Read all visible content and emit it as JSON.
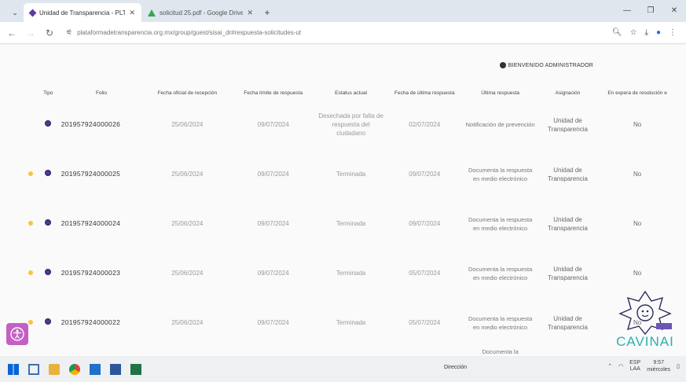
{
  "browser": {
    "tabs": [
      {
        "title": "Unidad de Transparencia - PLT",
        "active": true,
        "icon": "unidad-icon"
      },
      {
        "title": "solicitud 25.pdf - Google Drive",
        "active": false,
        "icon": "google-drive-icon"
      }
    ],
    "url": "plataformadetransparencia.org.mx/group/guest/sisai_dr#respuesta-solicitudes-ut",
    "new_tab": "+",
    "window_controls": [
      "—",
      "❐",
      "✕"
    ]
  },
  "header": {
    "welcome": "BIENVENIDO ADMINISTRADOR"
  },
  "table": {
    "columns": [
      "",
      "Tipo",
      "Folio",
      "Fecha oficial de recepción",
      "Fecha límite de respuesta",
      "Estatus actual",
      "Fecha de última respuesta",
      "Última respuesta",
      "Asignación",
      "En espera de resolución e"
    ],
    "rows": [
      {
        "marker": false,
        "folio": "201957924000026",
        "fecha_oficial": "25/06/2024",
        "fecha_limite": "09/07/2024",
        "estatus": "Desechada por falta de respuesta del ciudadano",
        "fecha_ultima": "02/07/2024",
        "ultima_respuesta": "Notificación de prevención",
        "asignacion": "Unidad de Transparencia",
        "espera": "No"
      },
      {
        "marker": true,
        "folio": "201957924000025",
        "fecha_oficial": "25/06/2024",
        "fecha_limite": "09/07/2024",
        "estatus": "Terminada",
        "fecha_ultima": "09/07/2024",
        "ultima_respuesta": "Documenta la respuesta en medio electrónico",
        "asignacion": "Unidad de Transparencia",
        "espera": "No"
      },
      {
        "marker": true,
        "folio": "201957924000024",
        "fecha_oficial": "25/06/2024",
        "fecha_limite": "09/07/2024",
        "estatus": "Terminada",
        "fecha_ultima": "09/07/2024",
        "ultima_respuesta": "Documenta la respuesta en medio electrónico",
        "asignacion": "Unidad de Transparencia",
        "espera": "No"
      },
      {
        "marker": true,
        "folio": "201957924000023",
        "fecha_oficial": "25/06/2024",
        "fecha_limite": "09/07/2024",
        "estatus": "Terminada",
        "fecha_ultima": "05/07/2024",
        "ultima_respuesta": "Documenta la respuesta en medio electrónico",
        "asignacion": "Unidad de Transparencia",
        "espera": "No"
      },
      {
        "marker": true,
        "folio": "201957924000022",
        "fecha_oficial": "25/06/2024",
        "fecha_limite": "09/07/2024",
        "estatus": "Terminada",
        "fecha_ultima": "05/07/2024",
        "ultima_respuesta": "Documenta la respuesta en medio electrónico",
        "asignacion": "Unidad de Transparencia",
        "espera": "No"
      }
    ],
    "partial_next_row": "Documenta la"
  },
  "overlay": {
    "brand": "CAVINAI"
  },
  "taskbar": {
    "center_label": "Dirección",
    "lang": "ESP",
    "lang_sub": "LAA",
    "time": "9:57",
    "day": "miércoles"
  },
  "colors": {
    "accent": "#4b3b8f",
    "marker": "#f5c542",
    "brand": "#2ab0b0",
    "accessibility": "#c45fc4"
  }
}
